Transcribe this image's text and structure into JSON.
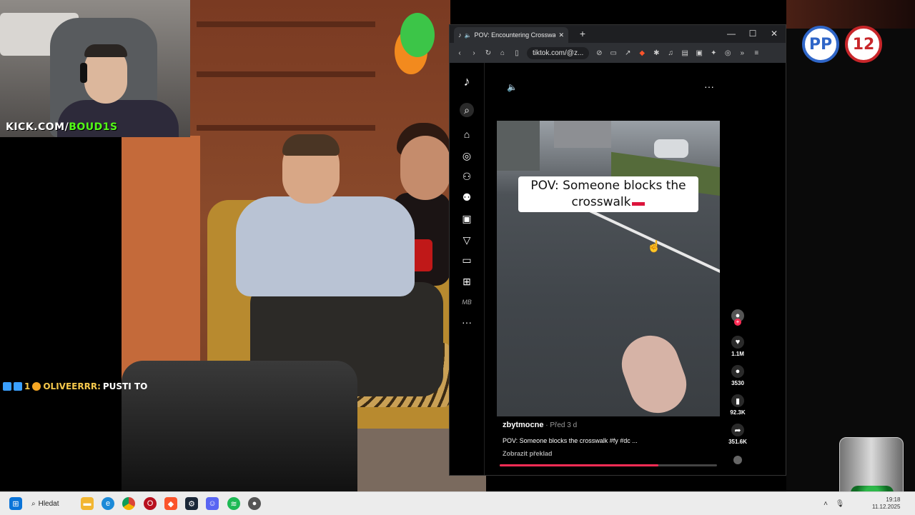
{
  "stream": {
    "kick_label_prefix": "KICK.COM/",
    "kick_label_name": "BOUD1S",
    "chat_user": "OLIVEERRR:",
    "chat_message": "PUSTI TO",
    "chat_badge_number": "1",
    "logo_left": "PP",
    "logo_right": "12"
  },
  "browser": {
    "tab_title": "POV: Encountering Crosswalk",
    "url": "tiktok.com/@z...",
    "minimize": "—",
    "maximize": "☐",
    "close": "✕",
    "tab_close": "✕",
    "new_tab": "+"
  },
  "tiktok": {
    "sidebar_more_label": "MB",
    "video_caption_line1": "POV: Someone blocks the",
    "video_caption_line2": "crosswalk",
    "likes": "1.1M",
    "comments": "3530",
    "saves": "92.3K",
    "shares": "351.6K",
    "author": "zbytmocne",
    "date": " · Před 3 d",
    "description": "POV: Someone blocks the crosswalk #fy #dc ...",
    "translate": "Zobrazit překlad",
    "progress": 0.73
  },
  "taskbar": {
    "search_label": "Hledat",
    "time": "19:18",
    "date": "11.12.2025"
  },
  "colors": {
    "tiktok_accent": "#fe2c55",
    "kick_green": "#53fc18"
  }
}
